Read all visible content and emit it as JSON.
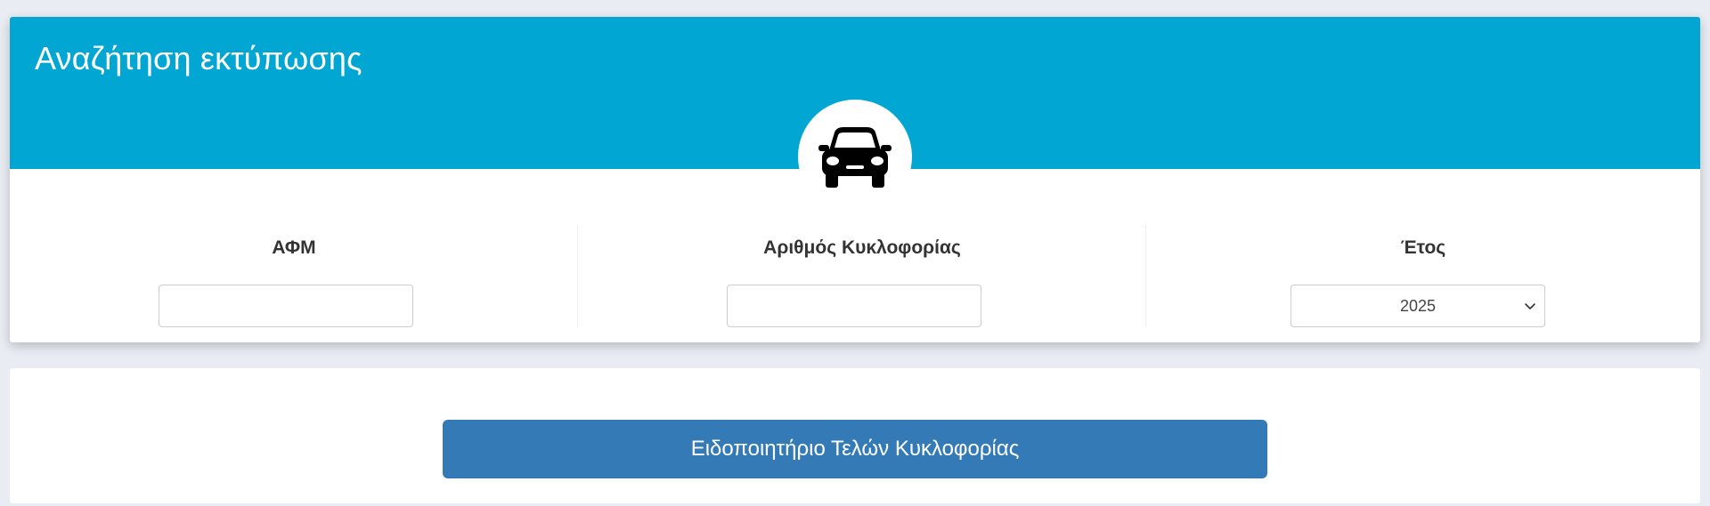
{
  "search_card": {
    "title": "Αναζήτηση εκτύπωσης",
    "badge_icon": "car-icon",
    "fields": [
      {
        "label": "ΑΦΜ",
        "value": "",
        "type": "text"
      },
      {
        "label": "Αριθμός Κυκλοφορίας",
        "value": "",
        "type": "text"
      },
      {
        "label": "Έτος",
        "value": "2025",
        "type": "select"
      }
    ]
  },
  "action_card": {
    "button_label": "Ειδοποιητήριο Τελών Κυκλοφορίας"
  },
  "colors": {
    "header_bg": "#02a6d3",
    "button_bg": "#337ab7",
    "page_bg": "#e9ecf3"
  }
}
